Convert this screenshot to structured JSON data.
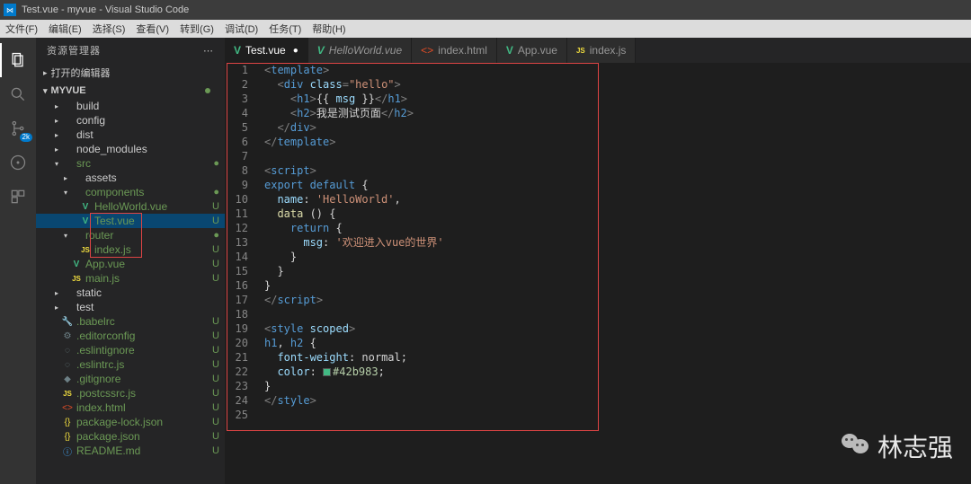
{
  "titlebar": {
    "text": "Test.vue - myvue - Visual Studio Code"
  },
  "menubar": [
    "文件(F)",
    "编辑(E)",
    "选择(S)",
    "查看(V)",
    "转到(G)",
    "调试(D)",
    "任务(T)",
    "帮助(H)"
  ],
  "activitybar": {
    "badge": "2k"
  },
  "sidebar": {
    "title": "资源管理器",
    "section_open": "打开的编辑器",
    "project": "MYVUE",
    "tree": [
      {
        "depth": 1,
        "tw": "▸",
        "icon": "folder",
        "iconText": "",
        "label": "build",
        "status": "",
        "cls": ""
      },
      {
        "depth": 1,
        "tw": "▸",
        "icon": "folder",
        "iconText": "",
        "label": "config",
        "status": "",
        "cls": ""
      },
      {
        "depth": 1,
        "tw": "▸",
        "icon": "folder",
        "iconText": "",
        "label": "dist",
        "status": "",
        "cls": ""
      },
      {
        "depth": 1,
        "tw": "▸",
        "icon": "folder",
        "iconText": "",
        "label": "node_modules",
        "status": "",
        "cls": ""
      },
      {
        "depth": 1,
        "tw": "▾",
        "icon": "folder",
        "iconText": "",
        "label": "src",
        "status": "●",
        "cls": "green"
      },
      {
        "depth": 2,
        "tw": "▸",
        "icon": "folder",
        "iconText": "",
        "label": "assets",
        "status": "",
        "cls": ""
      },
      {
        "depth": 2,
        "tw": "▾",
        "icon": "folder",
        "iconText": "",
        "label": "components",
        "status": "●",
        "cls": "green"
      },
      {
        "depth": 3,
        "tw": "",
        "icon": "vue",
        "iconText": "V",
        "label": "HelloWorld.vue",
        "status": "U",
        "cls": "green"
      },
      {
        "depth": 3,
        "tw": "",
        "icon": "vue",
        "iconText": "V",
        "label": "Test.vue",
        "status": "U",
        "cls": "green",
        "selected": true
      },
      {
        "depth": 2,
        "tw": "▾",
        "icon": "folder",
        "iconText": "",
        "label": "router",
        "status": "●",
        "cls": "green"
      },
      {
        "depth": 3,
        "tw": "",
        "icon": "js",
        "iconText": "JS",
        "label": "index.js",
        "status": "U",
        "cls": "green"
      },
      {
        "depth": 2,
        "tw": "",
        "icon": "vue",
        "iconText": "V",
        "label": "App.vue",
        "status": "U",
        "cls": "green"
      },
      {
        "depth": 2,
        "tw": "",
        "icon": "js",
        "iconText": "JS",
        "label": "main.js",
        "status": "U",
        "cls": "green"
      },
      {
        "depth": 1,
        "tw": "▸",
        "icon": "folder",
        "iconText": "",
        "label": "static",
        "status": "",
        "cls": ""
      },
      {
        "depth": 1,
        "tw": "▸",
        "icon": "folder",
        "iconText": "",
        "label": "test",
        "status": "",
        "cls": ""
      },
      {
        "depth": 1,
        "tw": "",
        "icon": "cfg",
        "iconText": "🔧",
        "label": ".babelrc",
        "status": "U",
        "cls": "green"
      },
      {
        "depth": 1,
        "tw": "",
        "icon": "cfg",
        "iconText": "⚙",
        "label": ".editorconfig",
        "status": "U",
        "cls": "green"
      },
      {
        "depth": 1,
        "tw": "",
        "icon": "cfg",
        "iconText": "◌",
        "label": ".eslintignore",
        "status": "U",
        "cls": "green"
      },
      {
        "depth": 1,
        "tw": "",
        "icon": "cfg",
        "iconText": "◌",
        "label": ".eslintrc.js",
        "status": "U",
        "cls": "green"
      },
      {
        "depth": 1,
        "tw": "",
        "icon": "cfg",
        "iconText": "◆",
        "label": ".gitignore",
        "status": "U",
        "cls": "green"
      },
      {
        "depth": 1,
        "tw": "",
        "icon": "js",
        "iconText": "JS",
        "label": ".postcssrc.js",
        "status": "U",
        "cls": "green"
      },
      {
        "depth": 1,
        "tw": "",
        "icon": "html",
        "iconText": "<>",
        "label": "index.html",
        "status": "U",
        "cls": "green"
      },
      {
        "depth": 1,
        "tw": "",
        "icon": "json",
        "iconText": "{}",
        "label": "package-lock.json",
        "status": "U",
        "cls": "green"
      },
      {
        "depth": 1,
        "tw": "",
        "icon": "json",
        "iconText": "{}",
        "label": "package.json",
        "status": "U",
        "cls": "green"
      },
      {
        "depth": 1,
        "tw": "",
        "icon": "md",
        "iconText": "ⓘ",
        "label": "README.md",
        "status": "U",
        "cls": "green"
      }
    ]
  },
  "tabs": [
    {
      "icon": "vue",
      "iconText": "V",
      "label": "Test.vue",
      "active": true,
      "modified": true,
      "italic": false
    },
    {
      "icon": "vue",
      "iconText": "V",
      "label": "HelloWorld.vue",
      "active": false,
      "modified": false,
      "italic": true
    },
    {
      "icon": "html",
      "iconText": "<>",
      "label": "index.html",
      "active": false,
      "modified": false,
      "italic": false
    },
    {
      "icon": "vue",
      "iconText": "V",
      "label": "App.vue",
      "active": false,
      "modified": false,
      "italic": false
    },
    {
      "icon": "js",
      "iconText": "JS",
      "label": "index.js",
      "active": false,
      "modified": false,
      "italic": false
    }
  ],
  "code": {
    "line_count": 25,
    "lines": [
      [
        [
          "punct",
          "<"
        ],
        [
          "tag",
          "template"
        ],
        [
          "punct",
          ">"
        ]
      ],
      [
        [
          "txt",
          "  "
        ],
        [
          "punct",
          "<"
        ],
        [
          "tag",
          "div "
        ],
        [
          "attr",
          "class"
        ],
        [
          "punct",
          "="
        ],
        [
          "str",
          "\"hello\""
        ],
        [
          "punct",
          ">"
        ]
      ],
      [
        [
          "txt",
          "    "
        ],
        [
          "punct",
          "<"
        ],
        [
          "tag",
          "h1"
        ],
        [
          "punct",
          ">"
        ],
        [
          "txt",
          "{{ "
        ],
        [
          "prop",
          "msg"
        ],
        [
          "txt",
          " }}"
        ],
        [
          "punct",
          "</"
        ],
        [
          "tag",
          "h1"
        ],
        [
          "punct",
          ">"
        ]
      ],
      [
        [
          "txt",
          "    "
        ],
        [
          "punct",
          "<"
        ],
        [
          "tag",
          "h2"
        ],
        [
          "punct",
          ">"
        ],
        [
          "txt",
          "我是测试页面"
        ],
        [
          "punct",
          "</"
        ],
        [
          "tag",
          "h2"
        ],
        [
          "punct",
          ">"
        ]
      ],
      [
        [
          "txt",
          "  "
        ],
        [
          "punct",
          "</"
        ],
        [
          "tag",
          "div"
        ],
        [
          "punct",
          ">"
        ]
      ],
      [
        [
          "punct",
          "</"
        ],
        [
          "tag",
          "template"
        ],
        [
          "punct",
          ">"
        ]
      ],
      [],
      [
        [
          "punct",
          "<"
        ],
        [
          "tag",
          "script"
        ],
        [
          "punct",
          ">"
        ]
      ],
      [
        [
          "kw",
          "export default"
        ],
        [
          "txt",
          " {"
        ]
      ],
      [
        [
          "txt",
          "  "
        ],
        [
          "prop",
          "name"
        ],
        [
          "txt",
          ": "
        ],
        [
          "str",
          "'HelloWorld'"
        ],
        [
          "txt",
          ","
        ]
      ],
      [
        [
          "txt",
          "  "
        ],
        [
          "fn",
          "data"
        ],
        [
          "txt",
          " () "
        ],
        [
          "txt",
          "{"
        ]
      ],
      [
        [
          "txt",
          "    "
        ],
        [
          "kw",
          "return"
        ],
        [
          "txt",
          " {"
        ]
      ],
      [
        [
          "txt",
          "      "
        ],
        [
          "prop",
          "msg"
        ],
        [
          "txt",
          ": "
        ],
        [
          "str",
          "'欢迎进入vue的世界'"
        ]
      ],
      [
        [
          "txt",
          "    }"
        ]
      ],
      [
        [
          "txt",
          "  }"
        ]
      ],
      [
        [
          "txt",
          "}"
        ]
      ],
      [
        [
          "punct",
          "</"
        ],
        [
          "tag",
          "script"
        ],
        [
          "punct",
          ">"
        ]
      ],
      [],
      [
        [
          "punct",
          "<"
        ],
        [
          "tag",
          "style "
        ],
        [
          "attr",
          "scoped"
        ],
        [
          "punct",
          ">"
        ]
      ],
      [
        [
          "tag",
          "h1"
        ],
        [
          "txt",
          ", "
        ],
        [
          "tag",
          "h2"
        ],
        [
          "txt",
          " {"
        ]
      ],
      [
        [
          "txt",
          "  "
        ],
        [
          "prop",
          "font-weight"
        ],
        [
          "txt",
          ": "
        ],
        [
          "txt",
          "normal"
        ],
        [
          "txt",
          ";"
        ]
      ],
      [
        [
          "txt",
          "  "
        ],
        [
          "prop",
          "color"
        ],
        [
          "txt",
          ": "
        ],
        [
          "swatch",
          ""
        ],
        [
          "num",
          "#42b983"
        ],
        [
          "txt",
          ";"
        ]
      ],
      [
        [
          "txt",
          "}"
        ]
      ],
      [
        [
          "punct",
          "</"
        ],
        [
          "tag",
          "style"
        ],
        [
          "punct",
          ">"
        ]
      ],
      []
    ]
  },
  "watermark": "林志强"
}
